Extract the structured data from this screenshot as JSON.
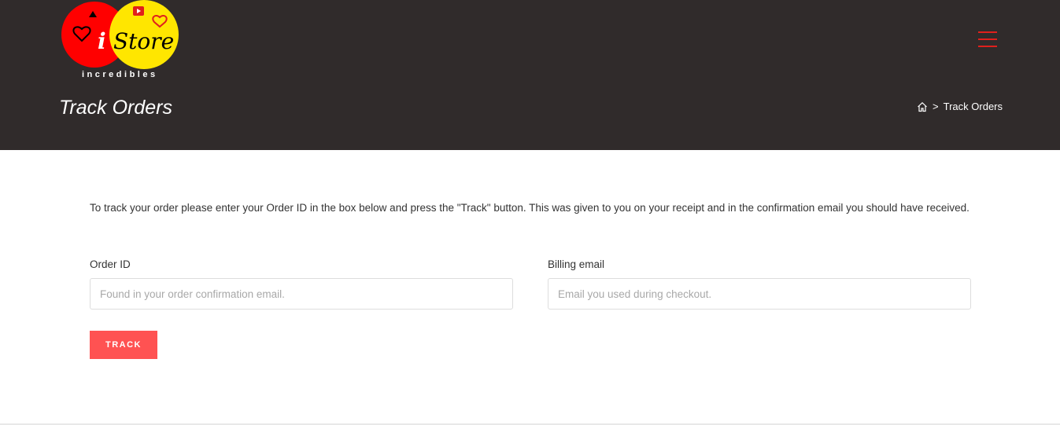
{
  "header": {
    "logo": {
      "brand_letter": "i",
      "brand_word": "Store",
      "tagline": "incredibles"
    },
    "menu_icon": "hamburger-icon",
    "page_title": "Track Orders",
    "breadcrumb": {
      "home_icon": "home-icon",
      "separator": ">",
      "current": "Track Orders"
    }
  },
  "main": {
    "intro_text": "To track your order please enter your Order ID in the box below and press the \"Track\" button. This was given to you on your receipt and in the confirmation email you should have received.",
    "order_id": {
      "label": "Order ID",
      "value": "",
      "placeholder": "Found in your order confirmation email."
    },
    "billing_email": {
      "label": "Billing email",
      "value": "",
      "placeholder": "Email you used during checkout."
    },
    "track_button_label": "TRACK"
  },
  "colors": {
    "header_bg": "#302b2b",
    "accent": "#ff5252",
    "menu_icon": "#e0201c",
    "logo_red": "#ff0000",
    "logo_yellow": "#ffe600"
  }
}
